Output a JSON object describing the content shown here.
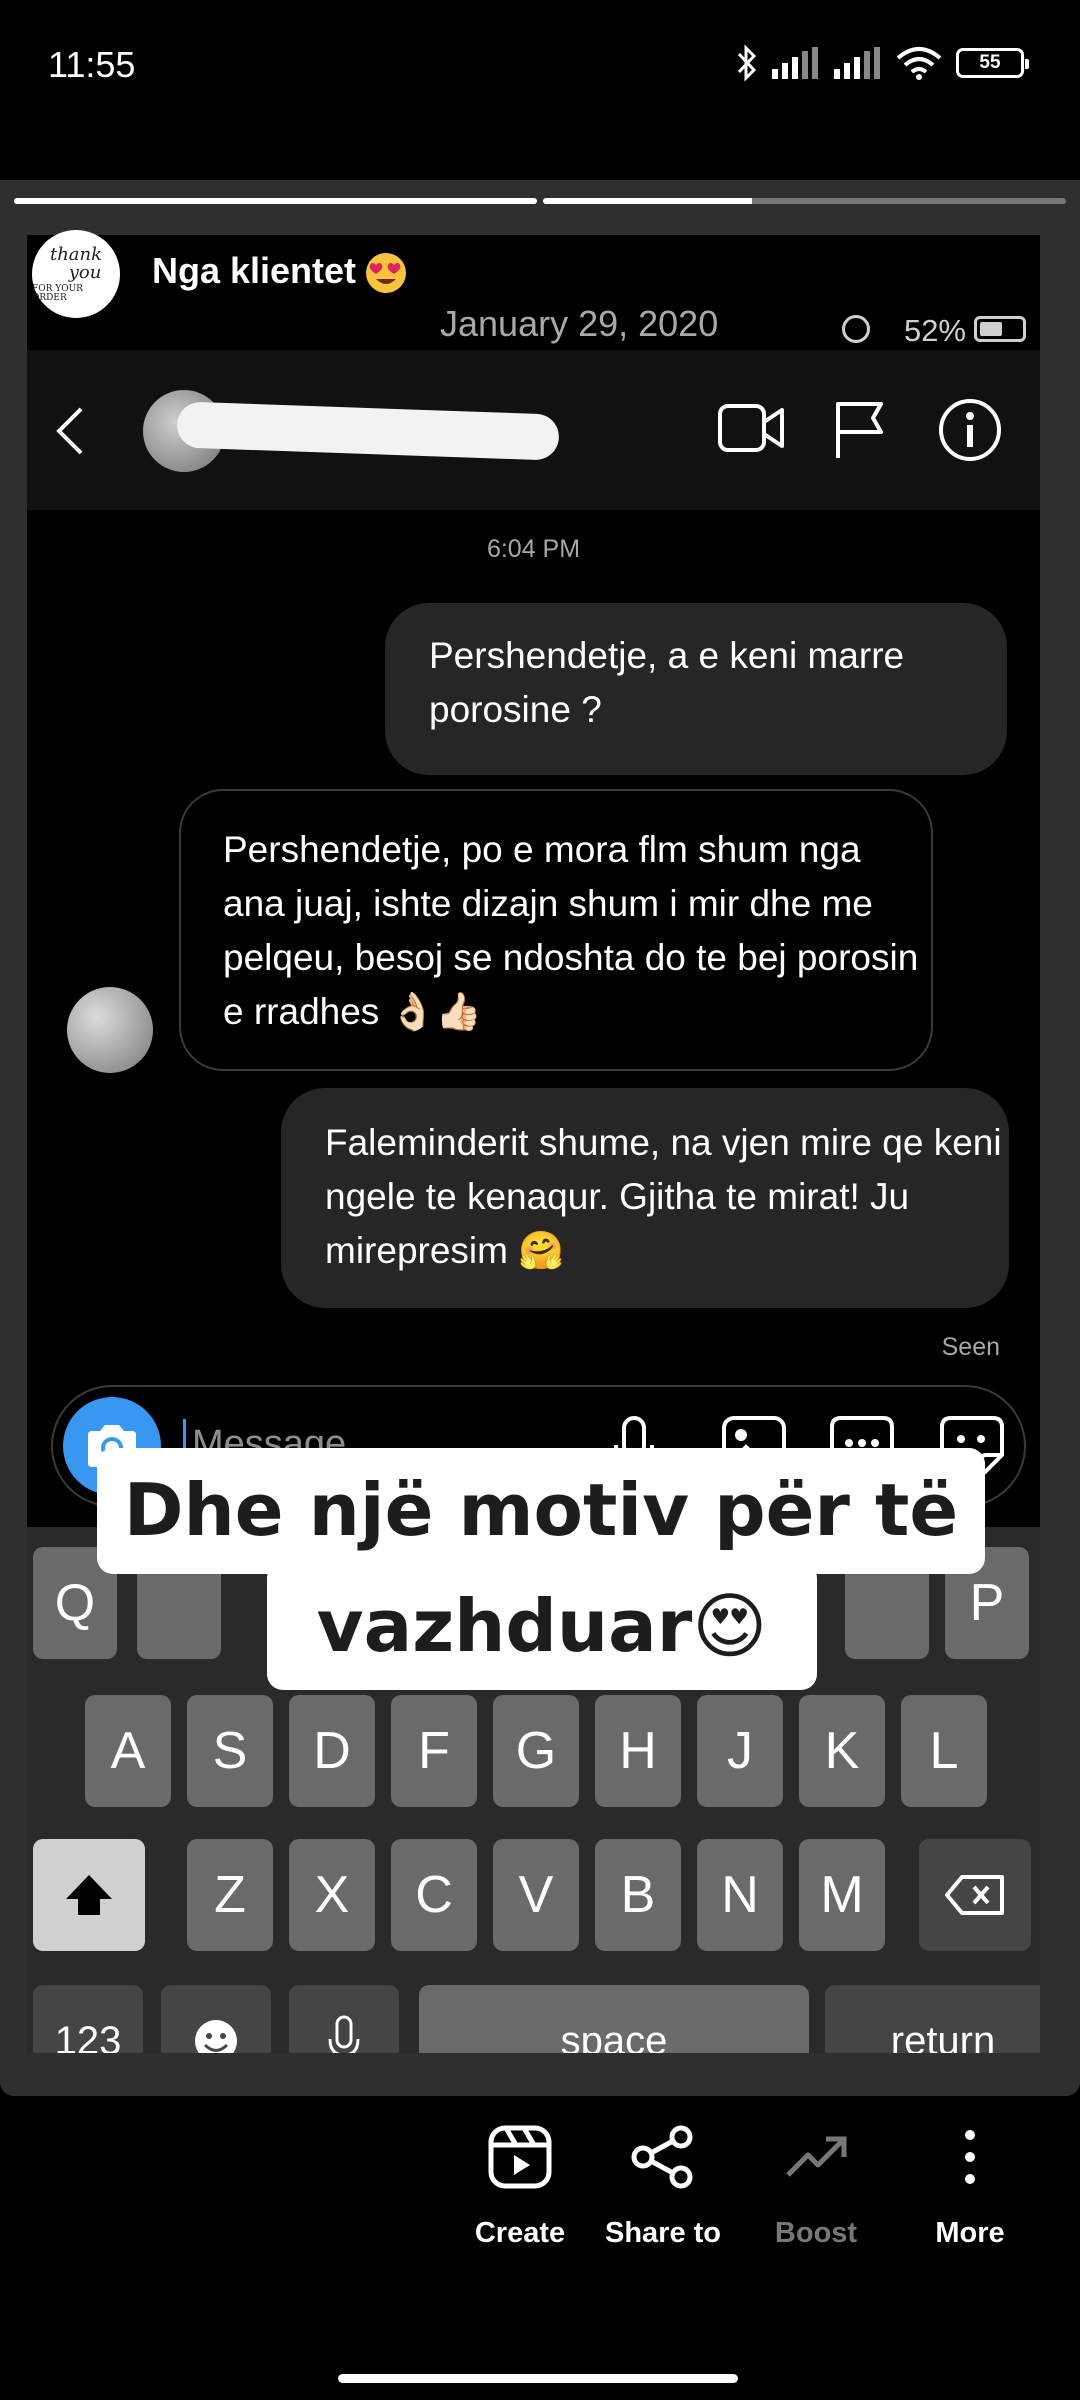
{
  "status_bar": {
    "time": "11:55",
    "battery": "55"
  },
  "story": {
    "progress": [
      1.0,
      0.4
    ],
    "title": "Nga klientet",
    "avatar_text": [
      "thank",
      "you",
      "FOR YOUR ORDER"
    ]
  },
  "screenshot": {
    "date": "January 29, 2020",
    "battery_text": "52%",
    "message_time": "6:04 PM",
    "messages": [
      {
        "dir": "out",
        "text": "Pershendetje, a e keni marre porosine ?"
      },
      {
        "dir": "in",
        "text": "Pershendetje, po e mora flm shum nga ana juaj, ishte dizajn shum i mir dhe me pelqeu, besoj se ndoshta do te bej porosin e rradhes 👌🏻👍🏻"
      },
      {
        "dir": "out",
        "text": "Faleminderit shume, na vjen mire qe keni ngele te kenaqur. Gjitha te mirat! Ju mirepresim 🤗"
      }
    ],
    "seen": "Seen",
    "compose_placeholder": "Message...",
    "keyboard": {
      "row1": [
        "Q",
        "P"
      ],
      "row2": [
        "A",
        "S",
        "D",
        "F",
        "G",
        "H",
        "J",
        "K",
        "L"
      ],
      "row3": [
        "Z",
        "X",
        "C",
        "V",
        "B",
        "N",
        "M"
      ],
      "numbers": "123",
      "space": "space",
      "return": "return"
    }
  },
  "overlay": {
    "line1": "Dhe një motiv për të",
    "line2": "vazhduar😍"
  },
  "actions": [
    {
      "label": "Create",
      "icon": "reels-icon",
      "enabled": true
    },
    {
      "label": "Share to",
      "icon": "share-icon",
      "enabled": true
    },
    {
      "label": "Boost",
      "icon": "trend-up-icon",
      "enabled": false
    },
    {
      "label": "More",
      "icon": "more-vertical-icon",
      "enabled": true
    }
  ]
}
